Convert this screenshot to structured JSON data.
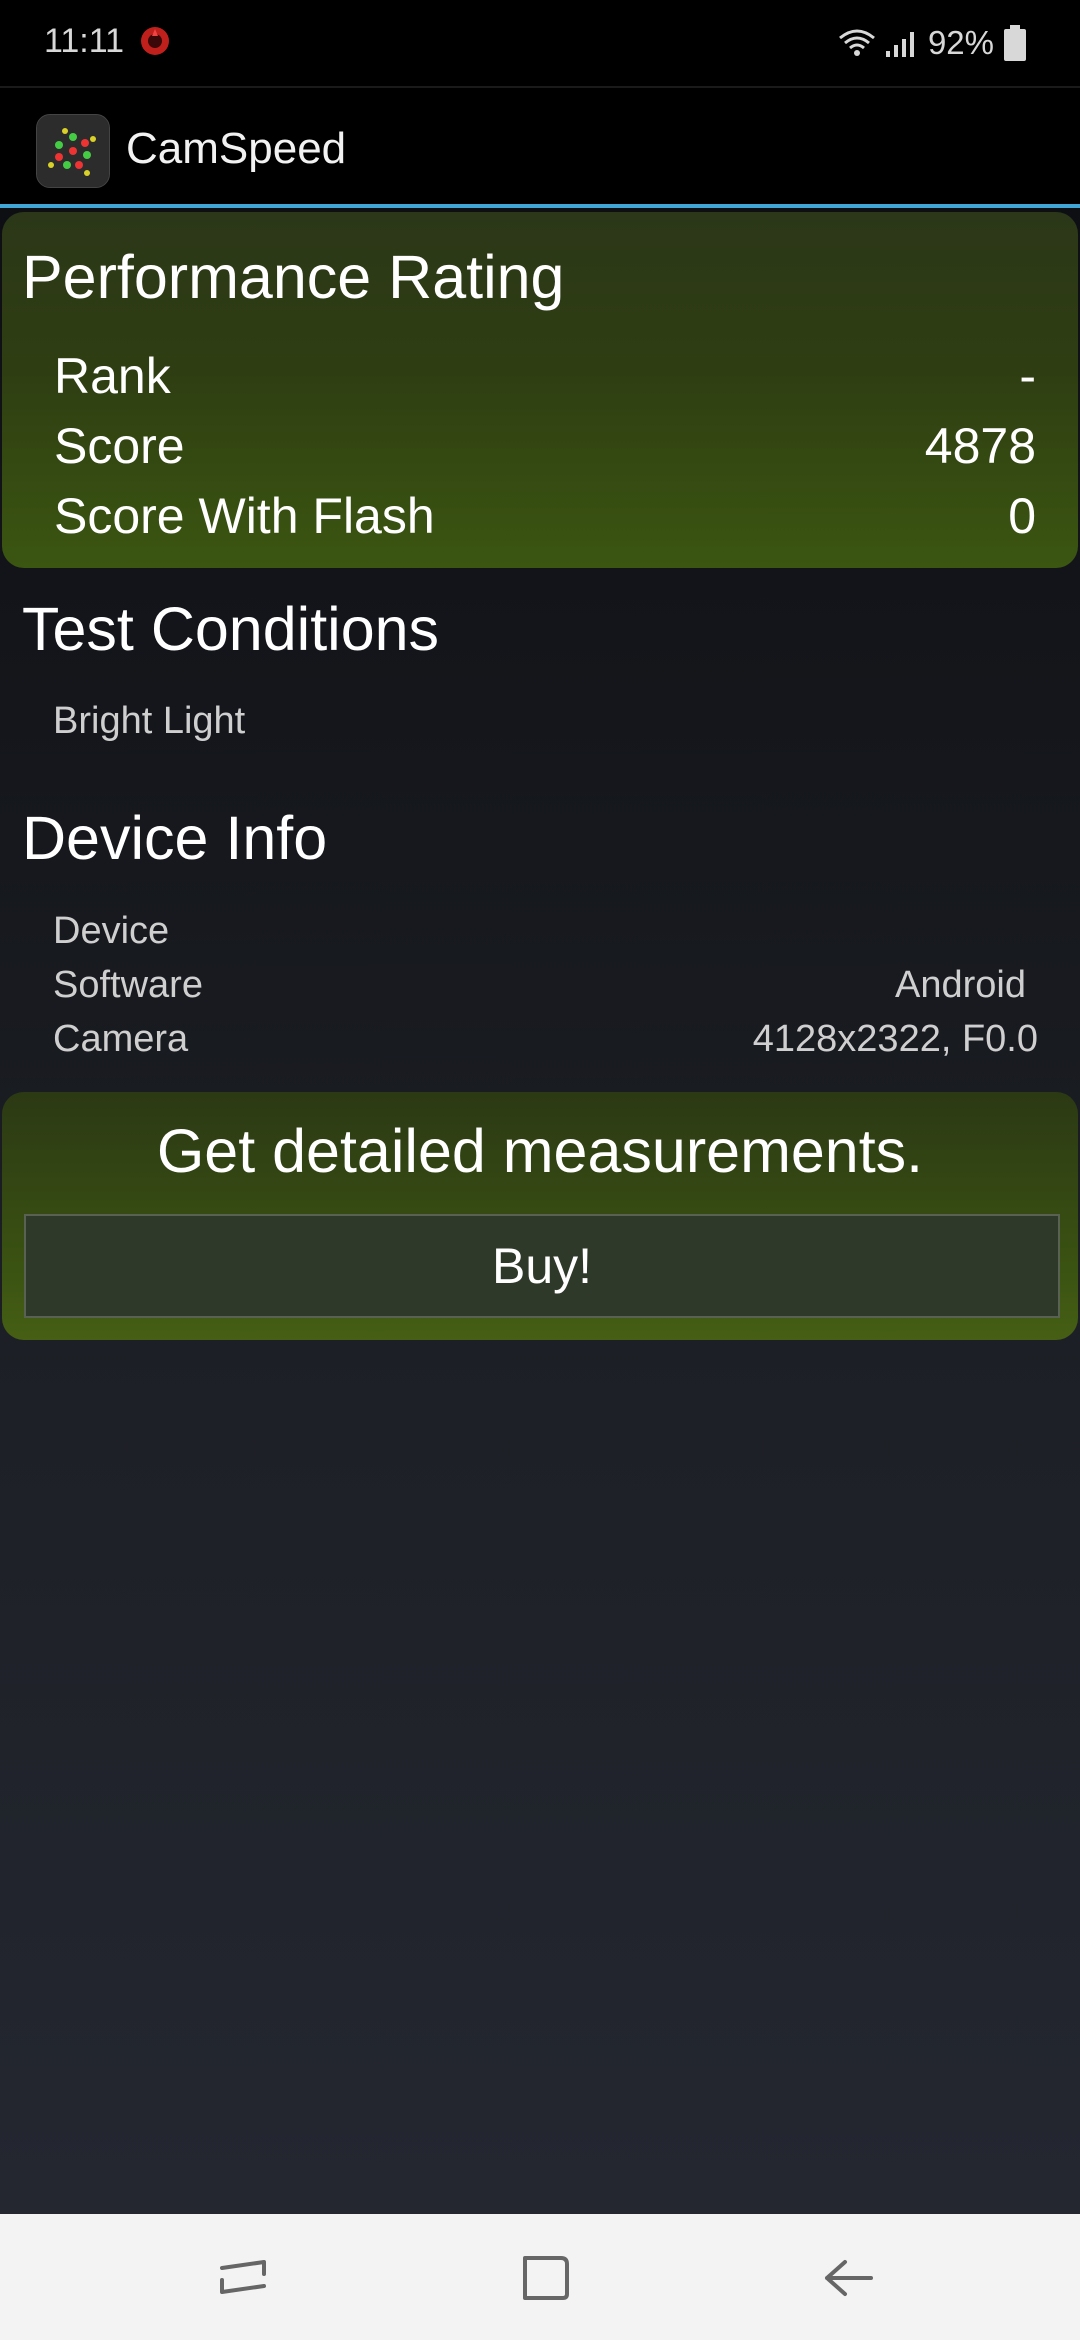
{
  "status_bar": {
    "time": "11:11",
    "battery": "92%",
    "notification_icon": "red-app-notification-icon",
    "icons": [
      "wifi-icon",
      "signal-icon",
      "battery-icon"
    ]
  },
  "app_bar": {
    "title": "CamSpeed",
    "icon": "camspeed-logo-icon"
  },
  "performance": {
    "heading": "Performance Rating",
    "rows": [
      {
        "label": "Rank",
        "value": "-"
      },
      {
        "label": "Score",
        "value": "4878"
      },
      {
        "label": "Score With Flash",
        "value": "0"
      }
    ]
  },
  "test_conditions": {
    "heading": "Test Conditions",
    "value": "Bright Light"
  },
  "device_info": {
    "heading": "Device Info",
    "rows": [
      {
        "label": "Device",
        "value": ""
      },
      {
        "label": "Software",
        "value": "Android"
      },
      {
        "label": "Camera",
        "value": "4128x2322, F0.0"
      }
    ]
  },
  "upsell": {
    "heading": "Get detailed measurements.",
    "button_label": "Buy!"
  },
  "nav_bar": {
    "icons": [
      "recent-apps-icon",
      "home-icon",
      "back-icon"
    ]
  },
  "colors": {
    "accent": "#3fa6d6",
    "card_green": "#3b5611"
  }
}
